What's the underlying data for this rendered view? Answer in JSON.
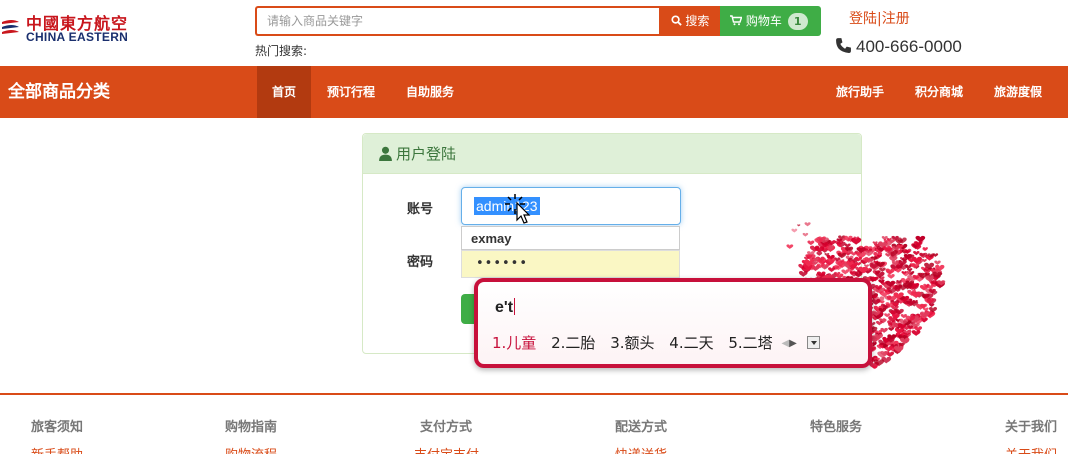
{
  "header": {
    "logo_cn": "中國東方航空",
    "logo_en": "CHINA EASTERN",
    "search_placeholder": "请输入商品关键字",
    "search_label": "搜索",
    "cart_label": "购物车",
    "cart_count": "1",
    "hot_search_label": "热门搜索:",
    "login_register": "登陆|注册",
    "phone": "400-666-0000"
  },
  "nav": {
    "all_categories": "全部商品分类",
    "items": [
      "首页",
      "预订行程",
      "自助服务",
      "旅行助手",
      "积分商城",
      "旅游度假"
    ]
  },
  "login": {
    "title": "用户登陆",
    "account_label": "账号",
    "account_value": "admin123",
    "suggestion": "exmay",
    "password_label": "密码",
    "password_value": "••••••"
  },
  "ime": {
    "composition": "e't",
    "candidates": [
      "1.儿童",
      "2.二胎",
      "3.额头",
      "4.二天",
      "5.二塔"
    ]
  },
  "footer": {
    "columns": [
      "旅客须知",
      "购物指南",
      "支付方式",
      "配送方式",
      "特色服务",
      "关于我们"
    ],
    "links": [
      "新手帮助",
      "购物流程",
      "支付宝支付",
      "快递送货",
      "",
      "关于我们"
    ]
  },
  "colors": {
    "brand_orange": "#d94b18",
    "cart_green": "#3fad46",
    "ime_red": "#c7103b"
  }
}
